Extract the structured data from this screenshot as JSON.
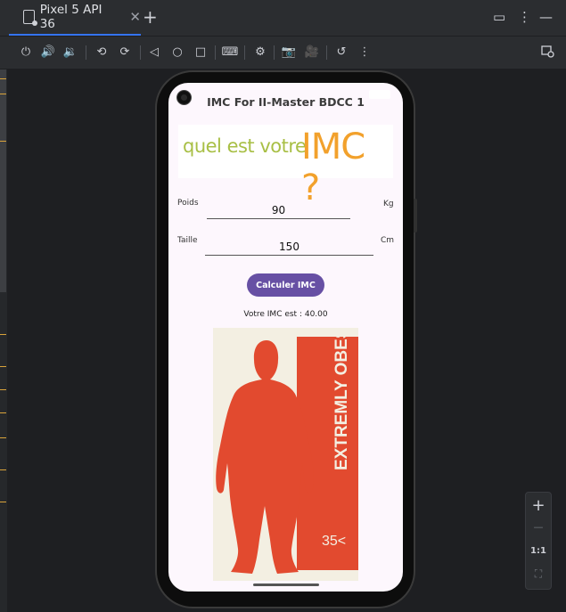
{
  "tab": {
    "title": "Pixel 5 API 36",
    "close_glyph": "✕"
  },
  "tab_add_glyph": "+",
  "window_controls": [
    "▭",
    "⋮",
    "—"
  ],
  "toolbar_icons": [
    "power-icon",
    "volume-up-icon",
    "volume-down-icon",
    "rotate-left-icon",
    "rotate-right-icon",
    "back-icon",
    "home-icon",
    "overview-icon",
    "keyboard-icon",
    "device-settings-icon",
    "camera-icon",
    "record-icon",
    "snapshot-icon",
    "more-icon"
  ],
  "toolbar_glyphs": [
    "⏻",
    "🔊",
    "🔉",
    "⟲",
    "⟳",
    "◁",
    "○",
    "□",
    "⌨",
    "⚙",
    "📷",
    "🎥",
    "↺",
    "⋮"
  ],
  "app": {
    "title": "IMC For II-Master BDCC 1",
    "banner_text_1": "quel est votre",
    "banner_text_2": "IMC ?",
    "weight_label": "Poids",
    "weight_value": "90",
    "weight_unit": "Kg",
    "height_label": "Taille",
    "height_value": "150",
    "height_unit": "Cm",
    "button_label": "Calculer IMC",
    "result_text": "Votre IMC est : 40.00",
    "image_text_1": "EXTREMLY OBESE",
    "image_text_2": "35<"
  },
  "zoom": {
    "in": "+",
    "out": "—",
    "ratio": "1:1",
    "fit": "⛶"
  },
  "colors": {
    "accent": "#3574f0",
    "button": "#6750a4",
    "banner_green": "#a8bf45",
    "banner_orange": "#f2a12c",
    "obese_red": "#e24a2f"
  }
}
